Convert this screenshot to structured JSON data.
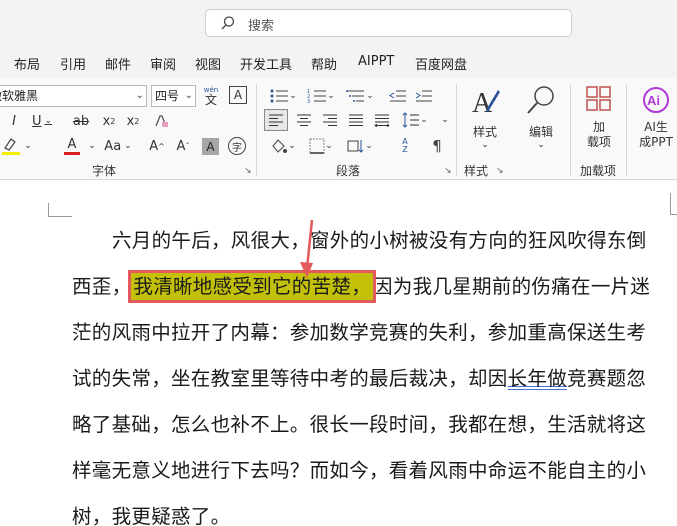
{
  "search": {
    "placeholder": "搜索"
  },
  "menu": {
    "tabs": [
      "布局",
      "引用",
      "邮件",
      "审阅",
      "视图",
      "开发工具",
      "帮助",
      "AIPPT",
      "百度网盘"
    ]
  },
  "ribbon": {
    "font_name": "微软雅黑",
    "font_size": "四号",
    "groups": {
      "font": "字体",
      "paragraph": "段落",
      "styles": "样式",
      "addins": "加载项"
    },
    "styles_button": "样式",
    "edit_button": "编辑",
    "addin_button": "加\n载项",
    "ai_button": "AI生\n成PPT",
    "wen_label": "wén",
    "wen_char": "文",
    "aa_label": "Aa",
    "x2": "x"
  },
  "document": {
    "lines": [
      "六月的午后，风很大，窗外的小树被没有方向的狂风吹得东倒",
      "西歪，",
      "我清晰地感受到它的苦楚，",
      "因为我几星期前的伤痛在一片迷",
      "茫的风雨中拉开了内幕：参加数学竞赛的失利，参加重高保送生考",
      "试的失常，坐在教室里等待中考的最后裁决，却因",
      "长年做",
      "竞赛题忽",
      "略了基础，怎么也补不上。很长一段时间，我都在想，生活就将这",
      "样毫无意义地进行下去吗？而如今，看着风雨中命运不能自主的小",
      "树，我更疑惑了。"
    ]
  },
  "colors": {
    "highlight": "#c3c00a",
    "annotation": "#e3595c",
    "accent": "#2b579a"
  }
}
